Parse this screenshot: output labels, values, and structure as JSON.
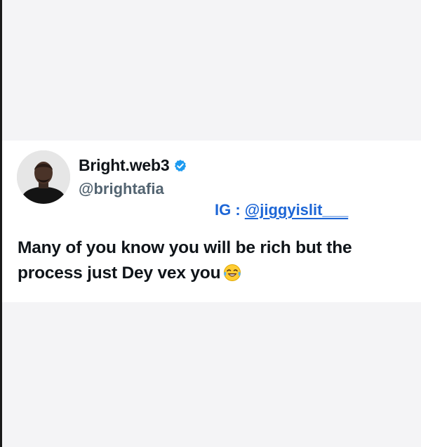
{
  "tweet": {
    "display_name": "Bright.web3",
    "handle": "@brightafia",
    "verified_icon": "verified-badge-icon",
    "ig_label": "IG : ",
    "ig_handle": "@jiggyislit___",
    "text": "Many of you know you will be rich but the process just Dey vex you",
    "emoji": "face-with-tears-of-joy-icon"
  },
  "colors": {
    "background": "#f4f4f6",
    "card": "#ffffff",
    "name": "#0f1419",
    "handle": "#536471",
    "ig_link": "#1d66d6",
    "verified": "#1d9bf0"
  }
}
